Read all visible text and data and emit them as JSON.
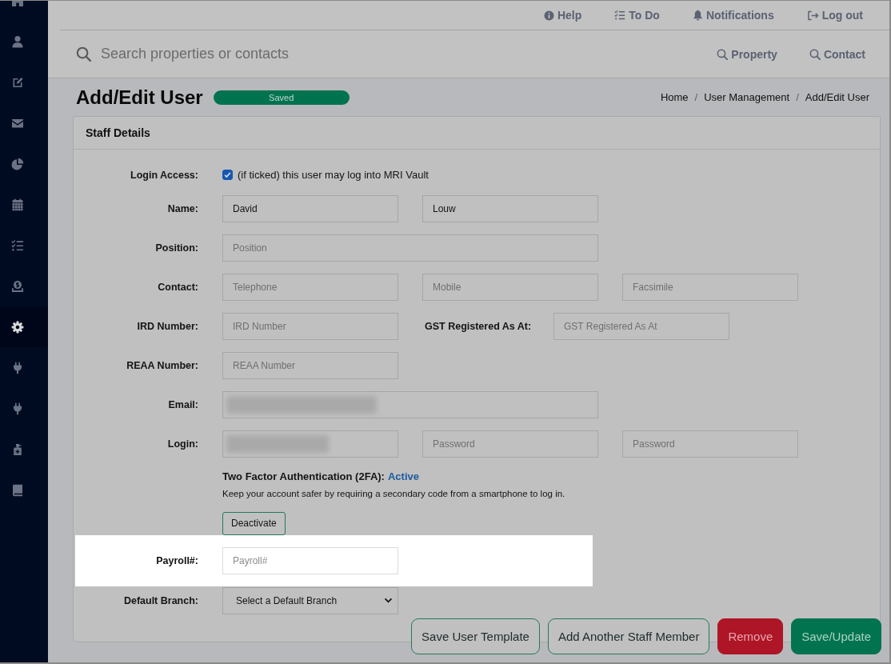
{
  "sidebar": {
    "items": [
      {
        "selected": false
      },
      {
        "selected": false
      },
      {
        "selected": false
      },
      {
        "selected": false
      },
      {
        "selected": false
      },
      {
        "selected": false
      },
      {
        "selected": false
      },
      {
        "selected": false
      },
      {
        "selected": true
      },
      {
        "selected": false
      },
      {
        "selected": false
      },
      {
        "selected": false
      },
      {
        "selected": false
      }
    ]
  },
  "top_links": [
    {
      "label": "Help"
    },
    {
      "label": "To Do"
    },
    {
      "label": "Notifications"
    },
    {
      "label": "Log out"
    }
  ],
  "search": {
    "placeholder": "Search properties or contacts",
    "scopes": [
      "Property",
      "Contact"
    ]
  },
  "page_header": {
    "title": "Add/Edit User",
    "badge": "Saved",
    "breadcrumbs": [
      {
        "label": "Home",
        "separator": "/"
      },
      {
        "label": "User Management",
        "separator": "/"
      },
      {
        "label": "Add/Edit User"
      }
    ]
  },
  "panel": {
    "title": "Staff Details",
    "rows": [
      {
        "kind": "checkbox",
        "label": "Login Access:",
        "checked": true,
        "text": "(if ticked) this user may log into MRI Vault",
        "highlighted": false
      },
      {
        "kind": "fields",
        "label": "Name:",
        "highlighted": false,
        "fields": [
          {
            "value": "David",
            "blurred": false
          },
          {
            "value": "Louw",
            "blurred": false
          }
        ]
      },
      {
        "kind": "wide-field",
        "label": "Position:",
        "highlighted": false,
        "fields": [
          {
            "placeholder": "Position",
            "blurred": false
          }
        ]
      },
      {
        "kind": "fields",
        "label": "Contact:",
        "highlighted": false,
        "fields": [
          {
            "placeholder": "Telephone",
            "blurred": false
          },
          {
            "placeholder": "Mobile",
            "blurred": false
          },
          {
            "placeholder": "Facsimile",
            "blurred": false
          }
        ]
      },
      {
        "kind": "fields",
        "label": "IRD Number:",
        "highlighted": false,
        "fields": [
          {
            "placeholder": "IRD Number",
            "blurred": false
          }
        ],
        "side_label": "GST Registered As At:",
        "side_field": {
          "placeholder": "GST Registered As At",
          "blurred": false
        }
      },
      {
        "kind": "fields",
        "label": "REAA Number:",
        "highlighted": false,
        "fields": [
          {
            "placeholder": "REAA Number",
            "blurred": false
          }
        ]
      },
      {
        "kind": "wide-field",
        "label": "Email:",
        "highlighted": false,
        "fields": [
          {
            "blurred": true
          }
        ]
      },
      {
        "kind": "fields",
        "label": "Login:",
        "highlighted": false,
        "fields": [
          {
            "blurred": true
          },
          {
            "placeholder": "Password",
            "blurred": false
          },
          {
            "placeholder": "Password",
            "blurred": false
          }
        ]
      },
      {
        "kind": "two-factor",
        "heading": "Two Factor Authentication (2FA):",
        "status": "Active",
        "description": "Keep your account safer by requiring a secondary code from a smartphone to log in.",
        "button": "Deactivate",
        "highlighted": false
      },
      {
        "kind": "fields",
        "label": "Payroll#:",
        "highlighted": true,
        "fields": [
          {
            "placeholder": "Payroll#",
            "blurred": false
          }
        ]
      },
      {
        "kind": "select",
        "label": "Default Branch:",
        "value": "Select a Default Branch",
        "highlighted": false
      }
    ]
  },
  "actions": [
    {
      "label": "Save User Template",
      "kind": "outline"
    },
    {
      "label": "Add Another Staff Member",
      "kind": "outline"
    },
    {
      "label": "Remove",
      "kind": "danger"
    },
    {
      "label": "Save/Update",
      "kind": "primary"
    }
  ]
}
